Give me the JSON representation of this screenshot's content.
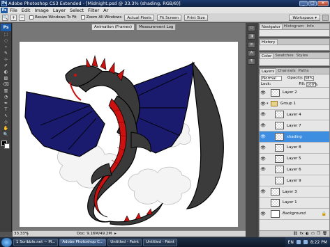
{
  "window": {
    "title": "Adobe Photoshop CS3 Extended - [Midnight.psd @ 33.3% (shading, RGB/8)]",
    "controls": [
      "_",
      "□",
      "✕"
    ]
  },
  "menu": {
    "ps_logo": "Ps",
    "items": [
      "File",
      "Edit",
      "Image",
      "Layer",
      "Select",
      "Filter",
      "Ar"
    ],
    "doc_tabs": [
      "Animation (Frames)",
      "Measurement Log"
    ]
  },
  "options": {
    "resize_windows_label": "Resize Windows To Fit",
    "zoom_all_label": "Zoom All Windows",
    "buttons": [
      "Actual Pixels",
      "Fit Screen",
      "Print Size"
    ],
    "workspace_label": "Workspace ▾"
  },
  "toolbox": {
    "header": "Ps",
    "tool_glyphs": [
      "⬚",
      "◌",
      "⌁",
      "✎",
      "⊹",
      "✐",
      "◐",
      "▨",
      "⌫",
      "▥",
      "◔",
      "✒",
      "T",
      "↖",
      "◇",
      "✋",
      "🔍"
    ]
  },
  "canvas": {
    "anim_tabs": [
      "Animation (Frames)",
      "Measurement Log"
    ]
  },
  "status": {
    "zoom": "33.33%",
    "doc": "Doc: 9.16M/49.2M"
  },
  "dock": {
    "icon_labels": [
      "⎔",
      "◨",
      "≡",
      "A",
      "¶"
    ]
  },
  "panels": {
    "nav_tabs": [
      "Navigator",
      "Histogram",
      "Info"
    ],
    "history_tabs": [
      "History"
    ],
    "color_tabs": [
      "Color",
      "Swatches",
      "Styles"
    ],
    "layers_tabs": [
      "Layers",
      "Channels",
      "Paths"
    ],
    "blend_mode": "Normal",
    "opacity_label": "Opacity:",
    "opacity_value": "38%",
    "fill_label": "Fill:",
    "fill_value": "100%",
    "lock_label": "Lock:",
    "footer_icons": [
      "⛓",
      "fx",
      "◐",
      "▭",
      "❒",
      "🗑"
    ]
  },
  "layers": [
    {
      "name": "Layer 2",
      "visible": true,
      "type": "layer"
    },
    {
      "name": "Group 1",
      "visible": true,
      "type": "group"
    },
    {
      "name": "Layer 4",
      "visible": true,
      "type": "child"
    },
    {
      "name": "Layer 7",
      "visible": true,
      "type": "child"
    },
    {
      "name": "shading",
      "visible": true,
      "type": "child",
      "selected": true
    },
    {
      "name": "Layer 8",
      "visible": true,
      "type": "child"
    },
    {
      "name": "Layer 5",
      "visible": true,
      "type": "child"
    },
    {
      "name": "Layer 6",
      "visible": true,
      "type": "child"
    },
    {
      "name": "Layer 9",
      "visible": false,
      "type": "child"
    },
    {
      "name": "Layer 3",
      "visible": true,
      "type": "layer"
    },
    {
      "name": "Layer 1",
      "visible": false,
      "type": "layer"
    },
    {
      "name": "Background",
      "visible": true,
      "type": "background"
    }
  ],
  "taskbar": {
    "items": [
      "1 Scribble.net ~ M...",
      "Adobe Photoshop C...",
      "Untitled - Paint",
      "Untitled - Paint"
    ],
    "tray_lang": "EN",
    "time": "8:22 PM"
  },
  "colors": {
    "wing": "#1a1a6e",
    "body": "#3a3a3a",
    "belly": "#cc1111",
    "selection": "#3d8ee0"
  }
}
